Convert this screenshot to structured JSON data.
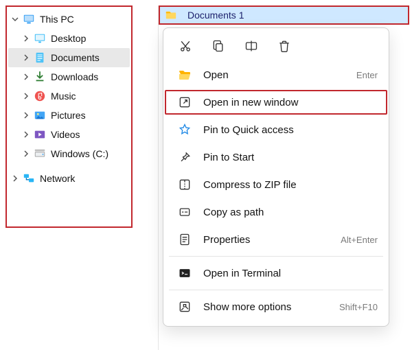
{
  "nav": {
    "this_pc": "This PC",
    "desktop": "Desktop",
    "documents": "Documents",
    "downloads": "Downloads",
    "music": "Music",
    "pictures": "Pictures",
    "videos": "Videos",
    "c_drive": "Windows (C:)",
    "network": "Network"
  },
  "content": {
    "selected_folder": "Documents 1"
  },
  "menu": {
    "open": "Open",
    "open_shortcut": "Enter",
    "open_new_window": "Open in new window",
    "pin_quick": "Pin to Quick access",
    "pin_start": "Pin to Start",
    "compress": "Compress to ZIP file",
    "copy_path": "Copy as path",
    "properties": "Properties",
    "properties_shortcut": "Alt+Enter",
    "terminal": "Open in Terminal",
    "more": "Show more options",
    "more_shortcut": "Shift+F10"
  }
}
